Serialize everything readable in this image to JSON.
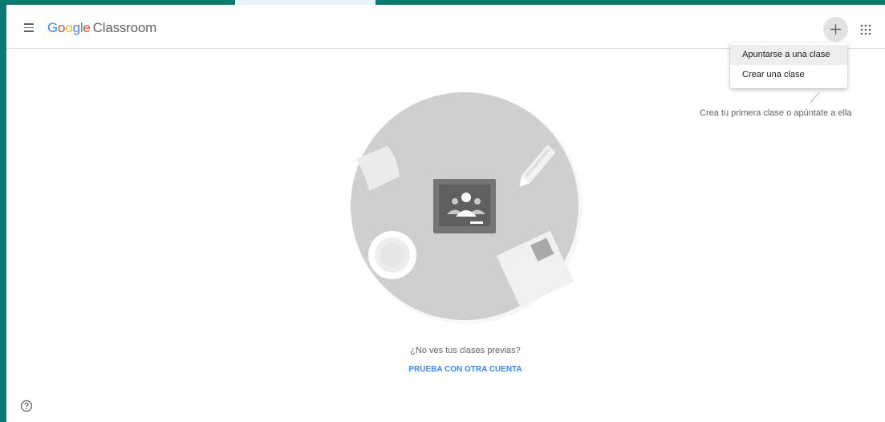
{
  "header": {
    "logo_parts": [
      "G",
      "o",
      "o",
      "g",
      "l",
      "e"
    ],
    "product_name": "Classroom",
    "menu_icon": "hamburger-menu-icon",
    "add_icon": "plus-icon",
    "apps_icon": "apps-grid-icon"
  },
  "dropdown": {
    "items": [
      {
        "label": "Apuntarse a una clase"
      },
      {
        "label": "Crear una clase"
      }
    ]
  },
  "hint": {
    "text": "Crea tu primera clase o apúntate a ella"
  },
  "empty_state": {
    "prompt": "¿No ves tus clases previas?",
    "link_label": "PRUEBA CON OTRA CUENTA"
  },
  "footer": {
    "help_icon": "help-icon"
  },
  "colors": {
    "frame": "#0b7a70",
    "link": "#4285f4",
    "circle": "#cfcfcf"
  }
}
